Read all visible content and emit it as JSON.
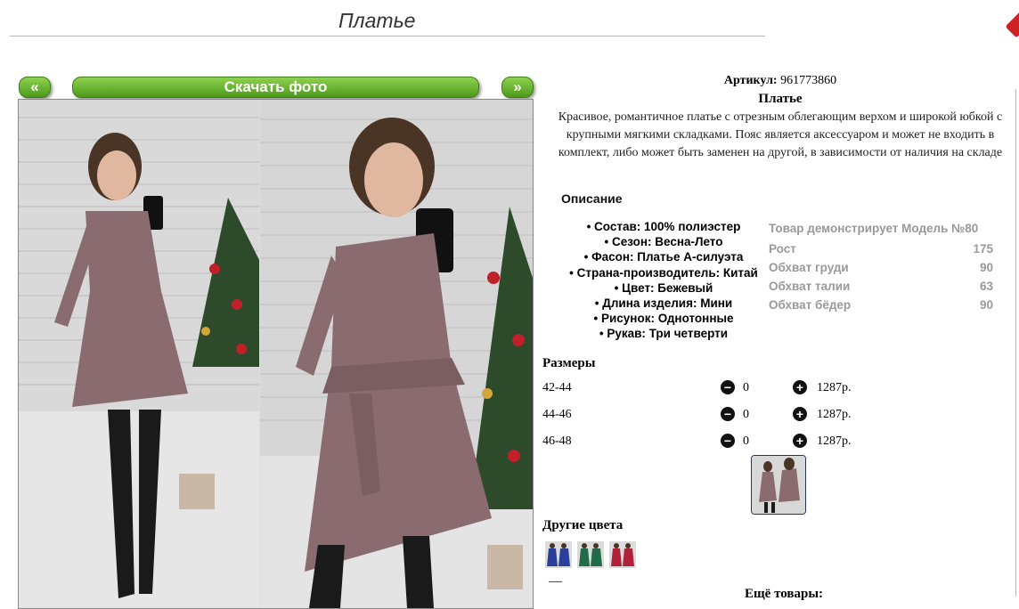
{
  "header": {
    "title": "Платье"
  },
  "gallery": {
    "prev_label": "«",
    "next_label": "»",
    "download_label": "Скачать фото"
  },
  "product": {
    "article_label": "Артикул:",
    "article_value": "961773860",
    "name": "Платье",
    "description": "Красивое, романтичное платье с отрезным облегающим верхом и широкой юбкой с крупными мягкими складками. Пояс является аксессуаром и может не входить в комплект, либо может быть заменен на другой, в зависимости от наличия на складе"
  },
  "description_section": {
    "heading": "Описание",
    "items": [
      "Состав: 100% полиэстер",
      "Сезон: Весна-Лето",
      "Фасон: Платье А-силуэта",
      "Страна-производитель: Китай",
      "Цвет: Бежевый",
      "Длина изделия: Мини",
      "Рисунок: Однотонные",
      "Рукав: Три четверти"
    ]
  },
  "model": {
    "heading": "Товар демонстрирует Модель №80",
    "rows": [
      {
        "label": "Рост",
        "value": "175"
      },
      {
        "label": "Обхват груди",
        "value": "90"
      },
      {
        "label": "Обхват талии",
        "value": "63"
      },
      {
        "label": "Обхват бёдер",
        "value": "90"
      }
    ]
  },
  "sizes": {
    "heading": "Размеры",
    "rows": [
      {
        "size": "42-44",
        "qty": "0",
        "price": "1287р."
      },
      {
        "size": "44-46",
        "qty": "0",
        "price": "1287р."
      },
      {
        "size": "46-48",
        "qty": "0",
        "price": "1287р."
      }
    ]
  },
  "other_colors": {
    "heading": "Другие цвета"
  },
  "footer": {
    "dash": "—",
    "more_heading": "Ещё товары:"
  },
  "colors": {
    "accent_green": "#5aa823",
    "dress": "#8a6c70",
    "thumb_colors": [
      "#2a3f9a",
      "#1f6b4a",
      "#b0213a"
    ]
  }
}
